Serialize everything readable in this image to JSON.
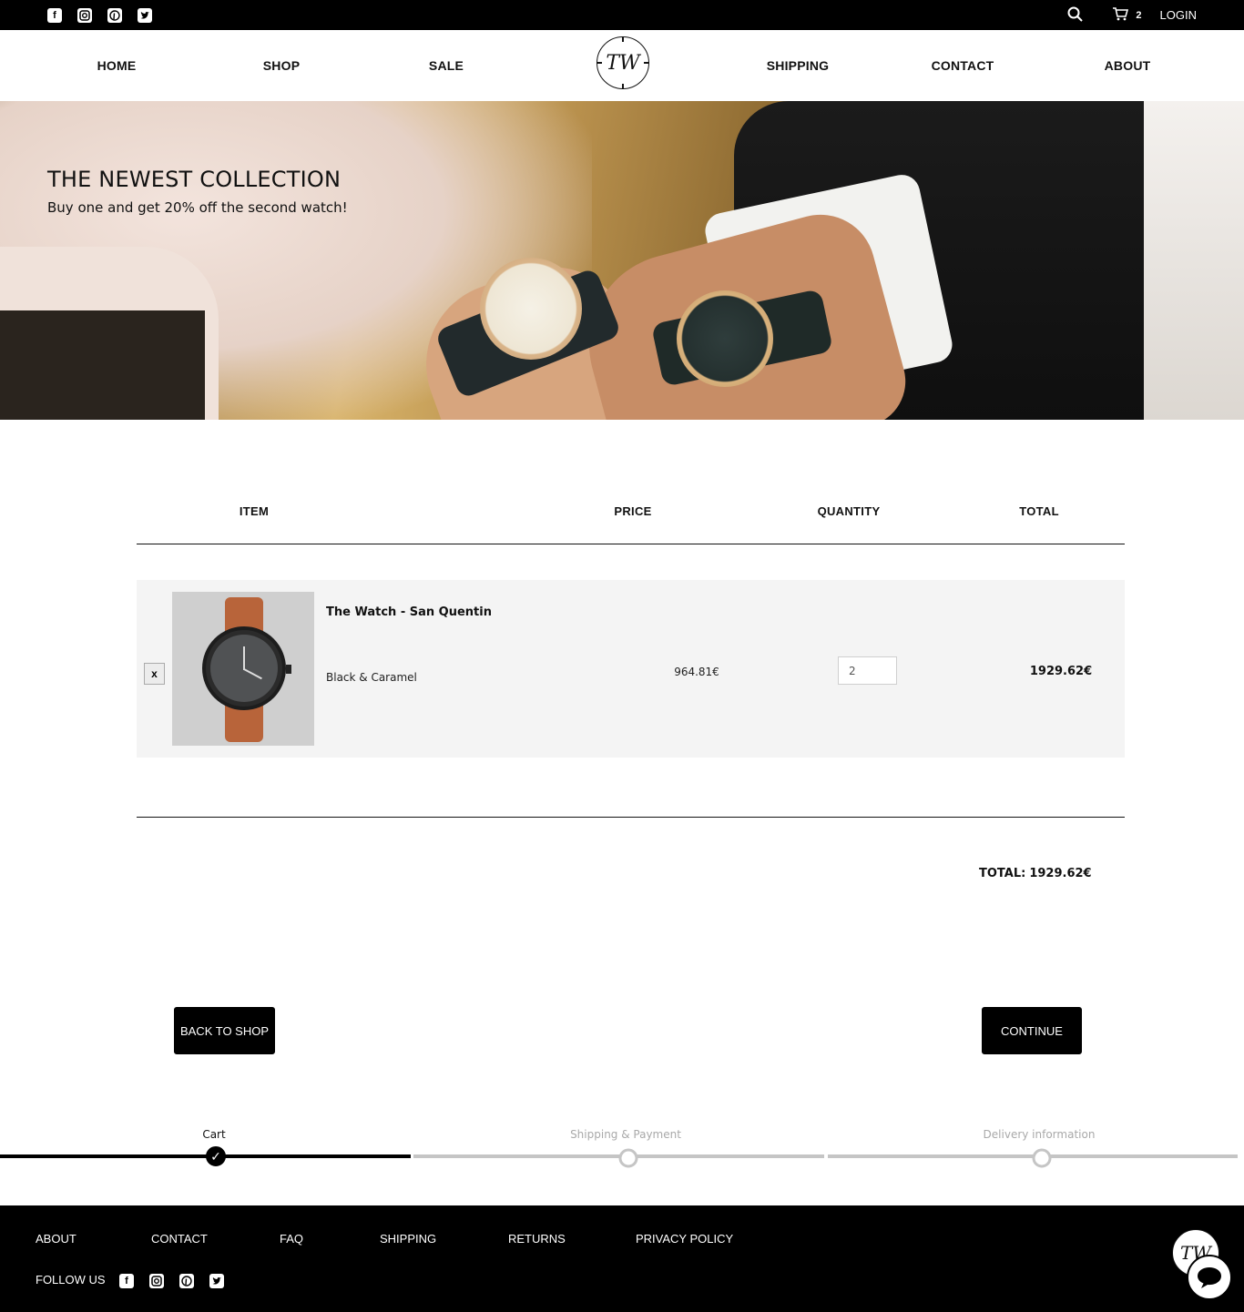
{
  "topbar": {
    "social_icons": [
      "facebook-icon",
      "instagram-icon",
      "pinterest-icon",
      "twitter-icon"
    ],
    "cart_count": "2",
    "login": "LOGIN"
  },
  "nav": {
    "items": [
      "HOME",
      "SHOP",
      "SALE",
      "SHIPPING",
      "CONTACT",
      "ABOUT"
    ],
    "logo": "TW"
  },
  "hero": {
    "title": "THE NEWEST COLLECTION",
    "subtitle": "Buy one and get 20% off the second watch!"
  },
  "cart": {
    "headers": {
      "item": "ITEM",
      "price": "PRICE",
      "quantity": "QUANTITY",
      "total": "TOTAL"
    },
    "items": [
      {
        "remove_label": "x",
        "name": "The Watch - San Quentin",
        "variant": "Black & Caramel",
        "price": "964.81€",
        "quantity": "2",
        "total": "1929.62€"
      }
    ],
    "grand_total_label": "TOTAL:",
    "grand_total": "1929.62€",
    "back_button": "BACK TO SHOP",
    "continue_button": "CONTINUE"
  },
  "progress": {
    "steps": [
      {
        "label": "Cart",
        "state": "done"
      },
      {
        "label": "Shipping & Payment",
        "state": "todo"
      },
      {
        "label": "Delivery information",
        "state": "todo"
      }
    ]
  },
  "footer": {
    "links": [
      "ABOUT",
      "CONTACT",
      "FAQ",
      "SHIPPING",
      "RETURNS",
      "PRIVACY POLICY"
    ],
    "follow_us": "FOLLOW US",
    "logo": "TW"
  },
  "colors": {
    "bar_background": "#000000",
    "row_background": "#f4f4f4",
    "progress_active": "#000000",
    "progress_inactive": "#c5c5c5"
  }
}
